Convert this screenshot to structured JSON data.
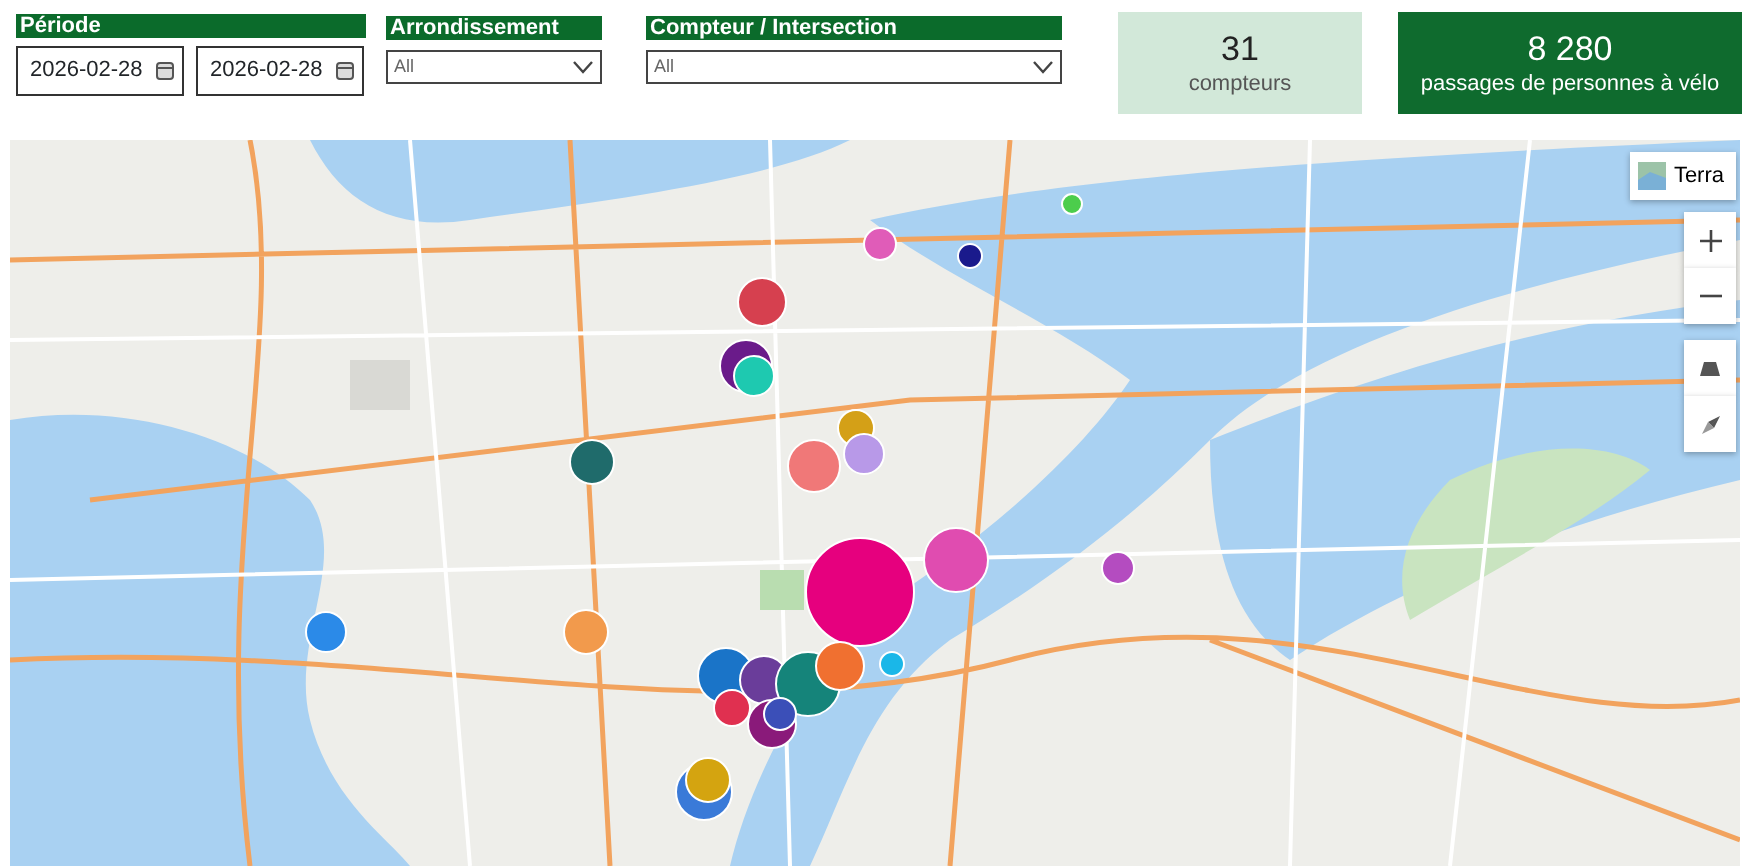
{
  "filters": [
    {
      "kind": "daterange",
      "label": "Période",
      "values": [
        "2026-02-28",
        "2026-02-28"
      ]
    },
    {
      "kind": "dropdown",
      "label": "Arrondissement",
      "value": "All"
    },
    {
      "kind": "dropdown",
      "label": "Compteur / Intersection",
      "value": "All"
    }
  ],
  "kpis": [
    {
      "kind": "light",
      "value": "31",
      "caption": "compteurs"
    },
    {
      "kind": "dark",
      "value": "8 280",
      "caption": "passages de personnes à vélo"
    }
  ],
  "map": {
    "layer_button": {
      "label": "Terra"
    },
    "bubbles": [
      {
        "color": "#e05cb8"
      },
      {
        "color": "#1a1a8c"
      },
      {
        "color": "#4ccd4c"
      },
      {
        "color": "#d6404f"
      },
      {
        "color": "#6a1b8a"
      },
      {
        "color": "#1ec9b0"
      },
      {
        "color": "#1f6b6b"
      },
      {
        "color": "#d4a017"
      },
      {
        "color": "#f07878"
      },
      {
        "color": "#b899e8"
      },
      {
        "color": "#e6007e"
      },
      {
        "color": "#e04cb0"
      },
      {
        "color": "#b44cc0"
      },
      {
        "color": "#2b8ae8"
      },
      {
        "color": "#f29a4c"
      },
      {
        "color": "#1ab7e8"
      },
      {
        "color": "#1a74c8"
      },
      {
        "color": "#6a3d9a"
      },
      {
        "color": "#15847a"
      },
      {
        "color": "#f07030"
      },
      {
        "color": "#e03050"
      },
      {
        "color": "#8a1a7a"
      },
      {
        "color": "#3b4fb8"
      },
      {
        "color": "#3a7ad8"
      },
      {
        "color": "#d4a410"
      }
    ]
  }
}
